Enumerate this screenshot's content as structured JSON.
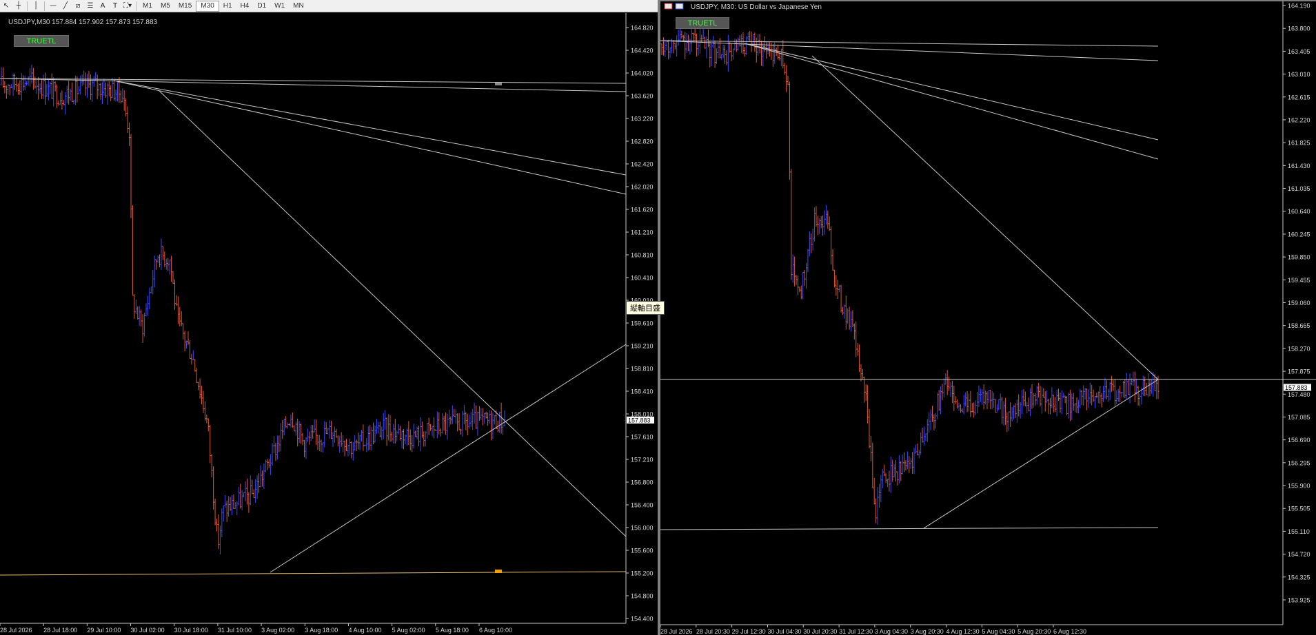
{
  "toolbar": {
    "tools": [
      {
        "name": "cursor-icon",
        "glyph": "↖"
      },
      {
        "name": "crosshair-icon",
        "glyph": "┼"
      },
      {
        "sep": true
      },
      {
        "name": "vertical-line-icon",
        "glyph": "│"
      },
      {
        "sep": true
      },
      {
        "name": "horizontal-line-icon",
        "glyph": "—"
      },
      {
        "name": "trendline-icon",
        "glyph": "╱"
      },
      {
        "name": "channel-icon",
        "glyph": "⧄"
      },
      {
        "name": "fibonacci-icon",
        "glyph": "☰"
      },
      {
        "name": "text-icon",
        "glyph": "A"
      },
      {
        "name": "text-label-icon",
        "glyph": "T"
      },
      {
        "name": "shapes-icon",
        "glyph": "⛶▾"
      }
    ],
    "timeframes": [
      "M1",
      "M5",
      "M15",
      "M30",
      "H1",
      "H4",
      "D1",
      "W1",
      "MN"
    ],
    "active_timeframe": "M30"
  },
  "tooltip": "縦軸目盛",
  "colors": {
    "bull": "#3b4bff",
    "bear": "#e05a2e",
    "grid": "#c8c8c8",
    "horizontal": "#e8c070",
    "price_bg": "#ffffff"
  },
  "charts": [
    {
      "id": "left",
      "header": "USDJPY,M30  157.884 157.902 157.873 157.883",
      "button": "TRUETL",
      "current_price": "157.883",
      "price_min": 154.4,
      "price_max": 165.0,
      "y_labels": [
        "164.820",
        "164.420",
        "164.020",
        "163.620",
        "163.220",
        "162.820",
        "162.420",
        "162.020",
        "161.620",
        "161.210",
        "160.810",
        "160.410",
        "160.010",
        "159.610",
        "159.210",
        "158.810",
        "158.410",
        "158.010",
        "157.610",
        "157.210",
        "156.800",
        "156.400",
        "156.000",
        "155.600",
        "155.200",
        "154.800",
        "154.400"
      ],
      "x_labels": [
        "28 Jul 2026",
        "28 Jul 18:00",
        "29 Jul 10:00",
        "30 Jul 02:00",
        "30 Jul 18:00",
        "31 Jul 10:00",
        "3 Aug 02:00",
        "3 Aug 18:00",
        "4 Aug 10:00",
        "5 Aug 02:00",
        "5 Aug 18:00",
        "6 Aug 10:00"
      ],
      "bars": 300
    },
    {
      "id": "right",
      "header": "USDJPY, M30:  US Dollar vs Japanese Yen",
      "button": "TRUETL",
      "current_price": "157.883",
      "price_min": 153.9,
      "price_max": 164.5,
      "y_labels": [
        "164.190",
        "163.800",
        "163.405",
        "163.010",
        "162.615",
        "162.220",
        "161.825",
        "161.430",
        "161.035",
        "160.640",
        "160.245",
        "159.850",
        "159.455",
        "159.060",
        "158.665",
        "158.270",
        "157.875",
        "157.480",
        "157.085",
        "156.690",
        "156.295",
        "155.900",
        "155.505",
        "155.110",
        "154.720",
        "154.325",
        "153.925"
      ],
      "x_labels": [
        "28 Jul 2026",
        "28 Jul 20:30",
        "29 Jul 12:30",
        "30 Jul 04:30",
        "30 Jul 20:30",
        "31 Jul 12:30",
        "3 Aug 04:30",
        "3 Aug 20:30",
        "4 Aug 12:30",
        "5 Aug 04:30",
        "5 Aug 20:30",
        "6 Aug 12:30"
      ],
      "bars": 300
    }
  ]
}
